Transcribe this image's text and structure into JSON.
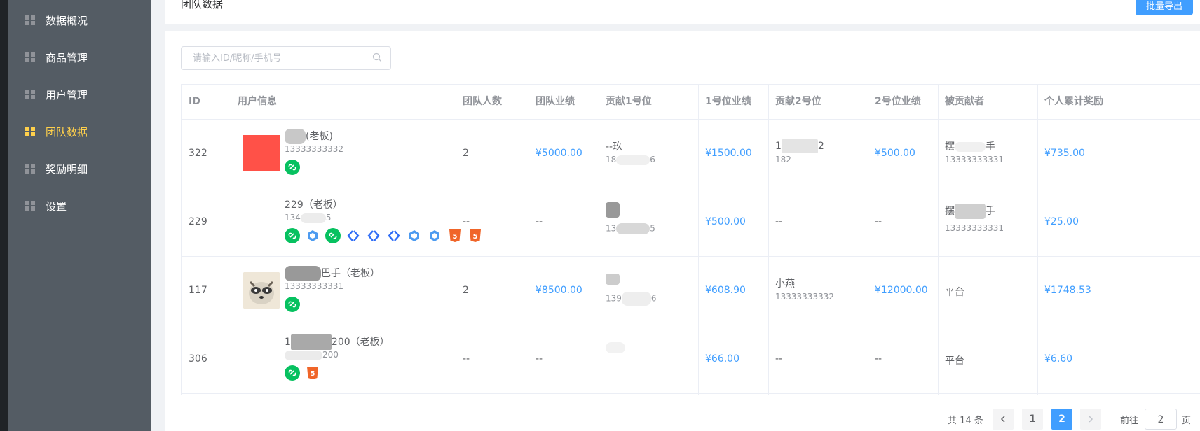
{
  "sidebar": {
    "items": [
      {
        "label": "数据概况",
        "active": false
      },
      {
        "label": "商品管理",
        "active": false
      },
      {
        "label": "用户管理",
        "active": false
      },
      {
        "label": "团队数据",
        "active": true
      },
      {
        "label": "奖励明细",
        "active": false
      },
      {
        "label": "设置",
        "active": false
      }
    ]
  },
  "header": {
    "title": "团队数据",
    "export_label": "批量导出"
  },
  "search": {
    "placeholder": "请输入ID/昵称/手机号",
    "value": ""
  },
  "table": {
    "columns": [
      "ID",
      "用户信息",
      "团队人数",
      "团队业绩",
      "贡献1号位",
      "1号位业绩",
      "贡献2号位",
      "2号位业绩",
      "被贡献者",
      "个人累计奖励"
    ],
    "rows": [
      {
        "id": "322",
        "name": "(老板)",
        "phone": "13333333332",
        "team_count": "2",
        "team_perf": "¥5000.00",
        "c1_name": "--玖",
        "c1_phone": "18",
        "c1_phone_tail": "6",
        "c1_perf": "¥1500.00",
        "c2_name": "1",
        "c2_name_tail": "2",
        "c2_phone": "182",
        "c2_perf": "¥500.00",
        "ben_name": "摆",
        "ben_name_tail": "手",
        "ben_phone": "13333333331",
        "reward": "¥735.00"
      },
      {
        "id": "229",
        "name": "229（老板）",
        "phone": "134",
        "phone_tail": "5",
        "team_count": "--",
        "team_perf": "--",
        "c1_name": "",
        "c1_phone": "13",
        "c1_phone_tail": "5",
        "c1_perf": "¥500.00",
        "c2_name": "--",
        "c2_perf": "--",
        "ben_name": "摆",
        "ben_name_tail": "手",
        "ben_phone": "13333333331",
        "reward": "¥25.00"
      },
      {
        "id": "117",
        "name": "巴手（老板）",
        "phone": "13333333331",
        "team_count": "2",
        "team_perf": "¥8500.00",
        "c1_name": "",
        "c1_phone": "139",
        "c1_phone_tail": "6",
        "c1_perf": "¥608.90",
        "c2_name": "小燕",
        "c2_phone": "13333333332",
        "c2_perf": "¥12000.00",
        "ben_name": "平台",
        "ben_phone": "",
        "reward": "¥1748.53"
      },
      {
        "id": "306",
        "name": "1",
        "name_tail": "200（老板）",
        "phone": "200",
        "team_count": "--",
        "team_perf": "--",
        "c1_name": "",
        "c1_phone": "",
        "c1_perf": "¥66.00",
        "c2_name": "--",
        "c2_perf": "--",
        "ben_name": "平台",
        "ben_phone": "",
        "reward": "¥6.60"
      }
    ]
  },
  "pagination": {
    "total_label": "共 14 条",
    "pages": [
      "1",
      "2"
    ],
    "current": "2",
    "goto_prefix": "前往",
    "goto_value": "2",
    "goto_suffix": "页"
  },
  "colors": {
    "primary": "#409eff",
    "sidebar_bg": "#545c64",
    "active": "#ffd04b",
    "wechat": "#07c160",
    "h5": "#f06529"
  }
}
